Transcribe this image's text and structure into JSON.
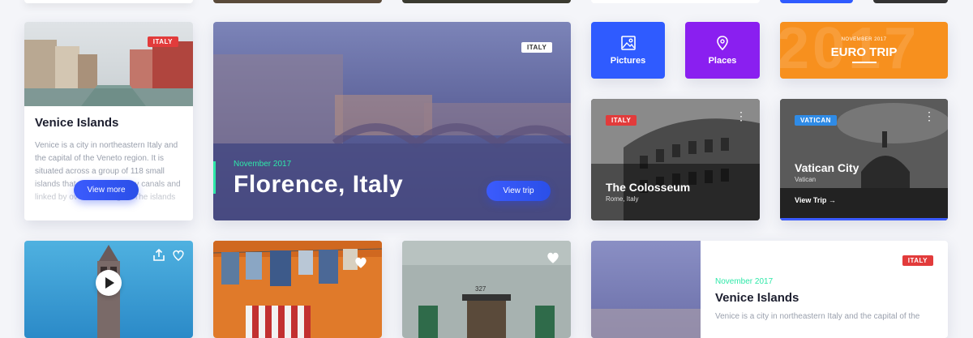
{
  "card_venice": {
    "tag": "ITALY",
    "title": "Venice Islands",
    "text": "Venice is a city in northeastern Italy and the capital of the Veneto region. It is situated across a group of 118 small islands that are separated by canals and linked by over 400 bridges. The islands are in the",
    "button": "View more"
  },
  "card_florence": {
    "tag": "ITALY",
    "date": "November 2017",
    "title": "Florence, Italy",
    "button": "View trip"
  },
  "tile_pictures": {
    "label": "Pictures",
    "icon": "image-icon",
    "color": "#2f5bff"
  },
  "tile_places": {
    "label": "Places",
    "icon": "location-pin-icon",
    "color": "#8a1ff0"
  },
  "card_eurotrip": {
    "date": "NOVEMBER 2017",
    "title": "EURO TRIP",
    "watermark": "2017",
    "color": "#f7901e"
  },
  "card_colosseum": {
    "tag": "ITALY",
    "title": "The Colosseum",
    "subtitle": "Rome, Italy"
  },
  "card_vatican": {
    "tag": "VATICAN",
    "title": "Vatican City",
    "subtitle": "Vatican",
    "link": "View Trip"
  },
  "card_video": {
    "icon": "play-icon"
  },
  "card_venice2": {
    "tag": "ITALY",
    "date": "November 2017",
    "title": "Venice Islands",
    "text": "Venice is a city in northeastern Italy and the capital of the"
  },
  "street_number": "327"
}
